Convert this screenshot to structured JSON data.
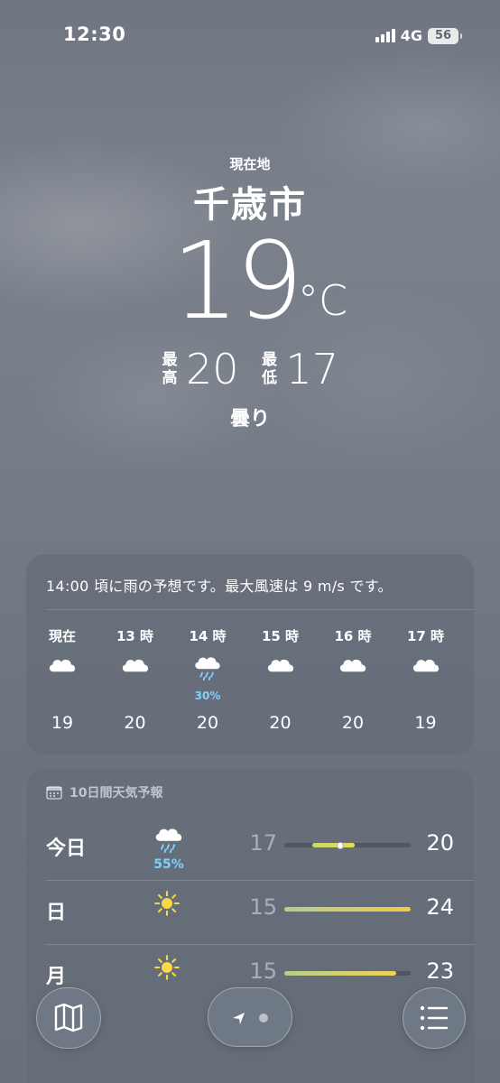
{
  "status": {
    "time": "12:30",
    "network": "4G",
    "battery": "56"
  },
  "location": {
    "label": "現在地",
    "city": "千歳市"
  },
  "current": {
    "temp": "19",
    "unit": "°C",
    "high_label": "最高",
    "high": "20",
    "low_label": "最低",
    "low": "17",
    "condition": "曇り"
  },
  "hourly": {
    "summary": "14:00 頃に雨の予想です。最大風速は 9 m/s です。",
    "items": [
      {
        "label": "現在",
        "icon": "cloud-icon",
        "temp": "19",
        "precip": ""
      },
      {
        "label": "13 時",
        "icon": "cloud-icon",
        "temp": "20",
        "precip": ""
      },
      {
        "label": "14 時",
        "icon": "cloud-rain-icon",
        "temp": "20",
        "precip": "30%"
      },
      {
        "label": "15 時",
        "icon": "cloud-icon",
        "temp": "20",
        "precip": ""
      },
      {
        "label": "16 時",
        "icon": "cloud-icon",
        "temp": "20",
        "precip": ""
      },
      {
        "label": "17 時",
        "icon": "cloud-icon",
        "temp": "19",
        "precip": ""
      }
    ]
  },
  "daily": {
    "header": "10日間天気予報",
    "header_icon": "calendar-icon",
    "range_min": 15,
    "range_max": 24,
    "items": [
      {
        "day": "今日",
        "icon": "cloud-rain-icon",
        "precip": "55%",
        "low": "17",
        "high": "20",
        "low_value": 17,
        "high_value": 20,
        "current": 19,
        "colors": [
          "#c9d76a",
          "#e6dc5a"
        ]
      },
      {
        "day": "日",
        "icon": "sun-icon",
        "precip": "",
        "low": "15",
        "high": "24",
        "low_value": 15,
        "high_value": 24,
        "colors": [
          "#b6cf8a",
          "#f2c94c"
        ]
      },
      {
        "day": "月",
        "icon": "sun-icon",
        "precip": "",
        "low": "15",
        "high": "23",
        "low_value": 15,
        "high_value": 23,
        "colors": [
          "#b6cf8a",
          "#efd25a"
        ]
      }
    ]
  },
  "toolbar": {
    "map_icon": "map-icon",
    "location_icon": "location-arrow-icon",
    "list_icon": "list-icon"
  },
  "colors": {
    "precip": "#7fd0ff",
    "accent_sun": "#f7d84a"
  }
}
